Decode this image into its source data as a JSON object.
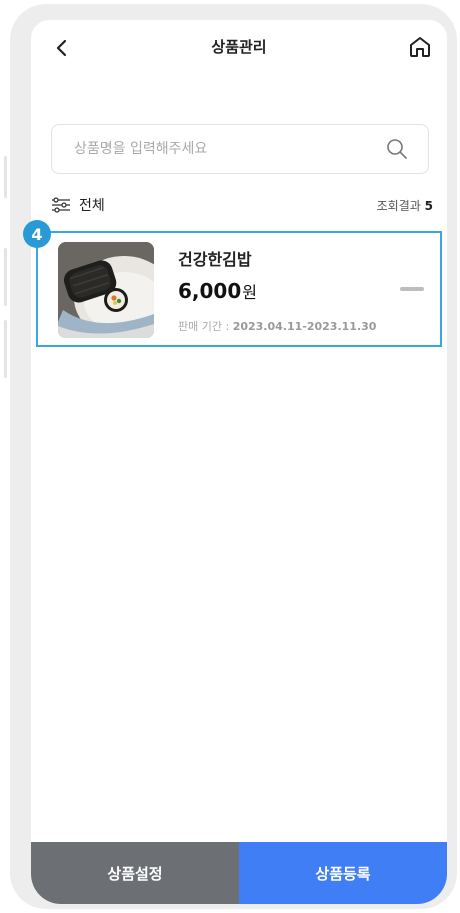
{
  "header": {
    "title": "상품관리",
    "back_icon": "chevron-left-icon",
    "home_icon": "home-icon"
  },
  "search": {
    "placeholder": "상품명을 입력해주세요",
    "icon": "search-icon"
  },
  "filter": {
    "label": "전체",
    "icon": "filter-sliders-icon",
    "result_prefix": "조회결과",
    "result_count": "5"
  },
  "products": [
    {
      "name": "건강한김밥",
      "price": "6,000",
      "currency": "원",
      "period_label": "판매 기간 :",
      "period": "2023.04.11-2023.11.30",
      "remove_icon": "minus-icon"
    }
  ],
  "step_badge": "4",
  "bottom": {
    "settings_label": "상품설정",
    "register_label": "상품등록"
  },
  "colors": {
    "accent": "#3f7ef4",
    "secondary_button": "#6c7075",
    "highlight": "#3aa8e0",
    "badge": "#2a9ad6"
  }
}
